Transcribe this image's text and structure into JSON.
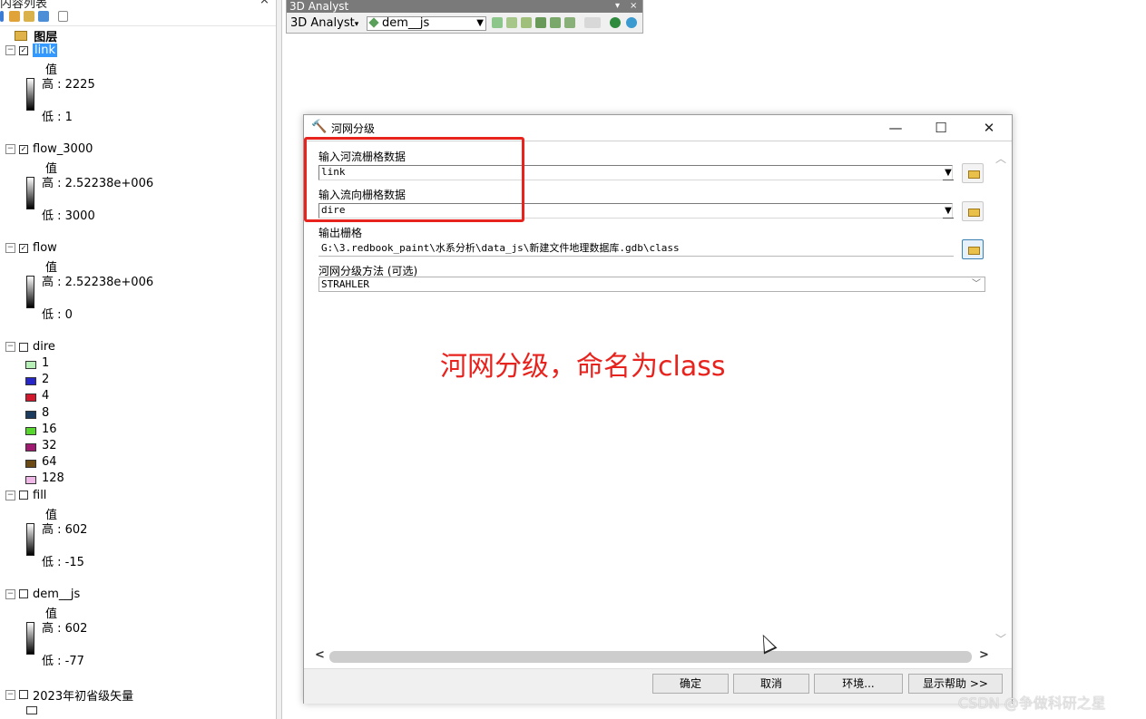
{
  "toc": {
    "title": "内容列表",
    "close_glyph": "×",
    "root_label": "图层",
    "layers": [
      {
        "name": "link",
        "checked": true,
        "expanded": true,
        "selected": true,
        "legend": {
          "type": "ramp",
          "heading": "值",
          "high": "高 : 2225",
          "low": "低 : 1"
        }
      },
      {
        "name": "flow_3000",
        "checked": true,
        "expanded": true,
        "legend": {
          "type": "ramp",
          "heading": "值",
          "high": "高 : 2.52238e+006",
          "low": "低 : 3000"
        }
      },
      {
        "name": "flow",
        "checked": true,
        "expanded": true,
        "legend": {
          "type": "ramp",
          "heading": "值",
          "high": "高 : 2.52238e+006",
          "low": "低 : 0"
        }
      },
      {
        "name": "dire",
        "checked": false,
        "expanded": true,
        "legend": {
          "type": "classes",
          "classes": [
            {
              "label": "1",
              "color": "#b7f0b7"
            },
            {
              "label": "2",
              "color": "#2626c9"
            },
            {
              "label": "4",
              "color": "#d3172c"
            },
            {
              "label": "8",
              "color": "#1a3b5e"
            },
            {
              "label": "16",
              "color": "#57d62e"
            },
            {
              "label": "32",
              "color": "#a11a72"
            },
            {
              "label": "64",
              "color": "#6b4a14"
            },
            {
              "label": "128",
              "color": "#f0b8e6"
            }
          ]
        }
      },
      {
        "name": "fill",
        "checked": false,
        "expanded": true,
        "legend": {
          "type": "ramp",
          "heading": "值",
          "high": "高 : 602",
          "low": "低 : -15"
        }
      },
      {
        "name": "dem__js",
        "checked": false,
        "expanded": true,
        "legend": {
          "type": "ramp",
          "heading": "值",
          "high": "高 : 602",
          "low": "低 : -77"
        }
      },
      {
        "name": "2023年初省级矢量",
        "checked": false,
        "expanded": true,
        "legend": {
          "type": "none"
        }
      }
    ]
  },
  "toolbar3d": {
    "title": "3D Analyst",
    "menu_label": "3D Analyst",
    "layer_combo": "dem__js",
    "min_glyph": "▾",
    "close_glyph": "×"
  },
  "dialog": {
    "title": "河网分级",
    "minimize": "—",
    "maximize": "☐",
    "close": "✕",
    "fields": {
      "input_stream_label": "输入河流栅格数据",
      "input_stream_value": "link",
      "input_direction_label": "输入流向栅格数据",
      "input_direction_value": "dire",
      "output_label": "输出栅格",
      "output_value": "G:\\3.redbook_paint\\水系分析\\data_js\\新建文件地理数据库.gdb\\class",
      "method_label": "河网分级方法 (可选)",
      "method_value": "STRAHLER"
    },
    "buttons": {
      "ok": "确定",
      "cancel": "取消",
      "env": "环境...",
      "help": "显示帮助 >>"
    },
    "annotation": "河网分级，命名为class",
    "annotation_color": "#e8221d"
  },
  "watermark": "CSDN @争做科研之星"
}
